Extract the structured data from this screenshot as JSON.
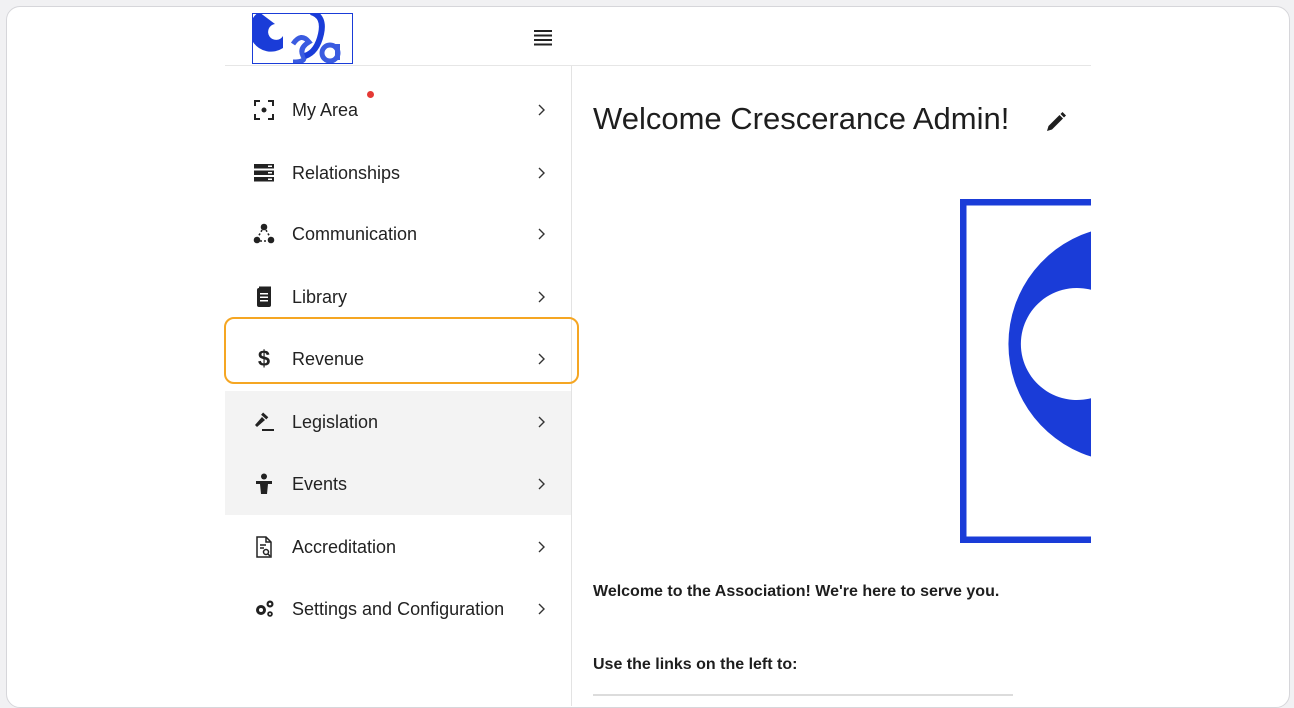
{
  "header": {
    "logo_text": "CsBa",
    "menu_toggle_icon": "hamburger-menu-icon"
  },
  "sidebar": {
    "items": [
      {
        "label": "My Area",
        "icon": "focus-frame-icon",
        "has_badge": true
      },
      {
        "label": "Relationships",
        "icon": "server-stack-icon"
      },
      {
        "label": "Communication",
        "icon": "network-nodes-icon"
      },
      {
        "label": "Library",
        "icon": "document-stack-icon"
      },
      {
        "label": "Revenue",
        "icon": "dollar-icon",
        "highlighted": true
      },
      {
        "label": "Legislation",
        "icon": "gavel-icon"
      },
      {
        "label": "Events",
        "icon": "person-podium-icon"
      },
      {
        "label": "Accreditation",
        "icon": "document-search-icon"
      },
      {
        "label": "Settings and Configuration",
        "icon": "gears-icon"
      }
    ]
  },
  "main": {
    "title": "Welcome Crescerance Admin!",
    "intro": "Welcome to the Association!  We're here to serve you.",
    "links_heading": "Use the links on the left to:"
  },
  "colors": {
    "brand_blue": "#1a3cd8",
    "highlight": "#f5a623",
    "badge": "#e53935"
  }
}
